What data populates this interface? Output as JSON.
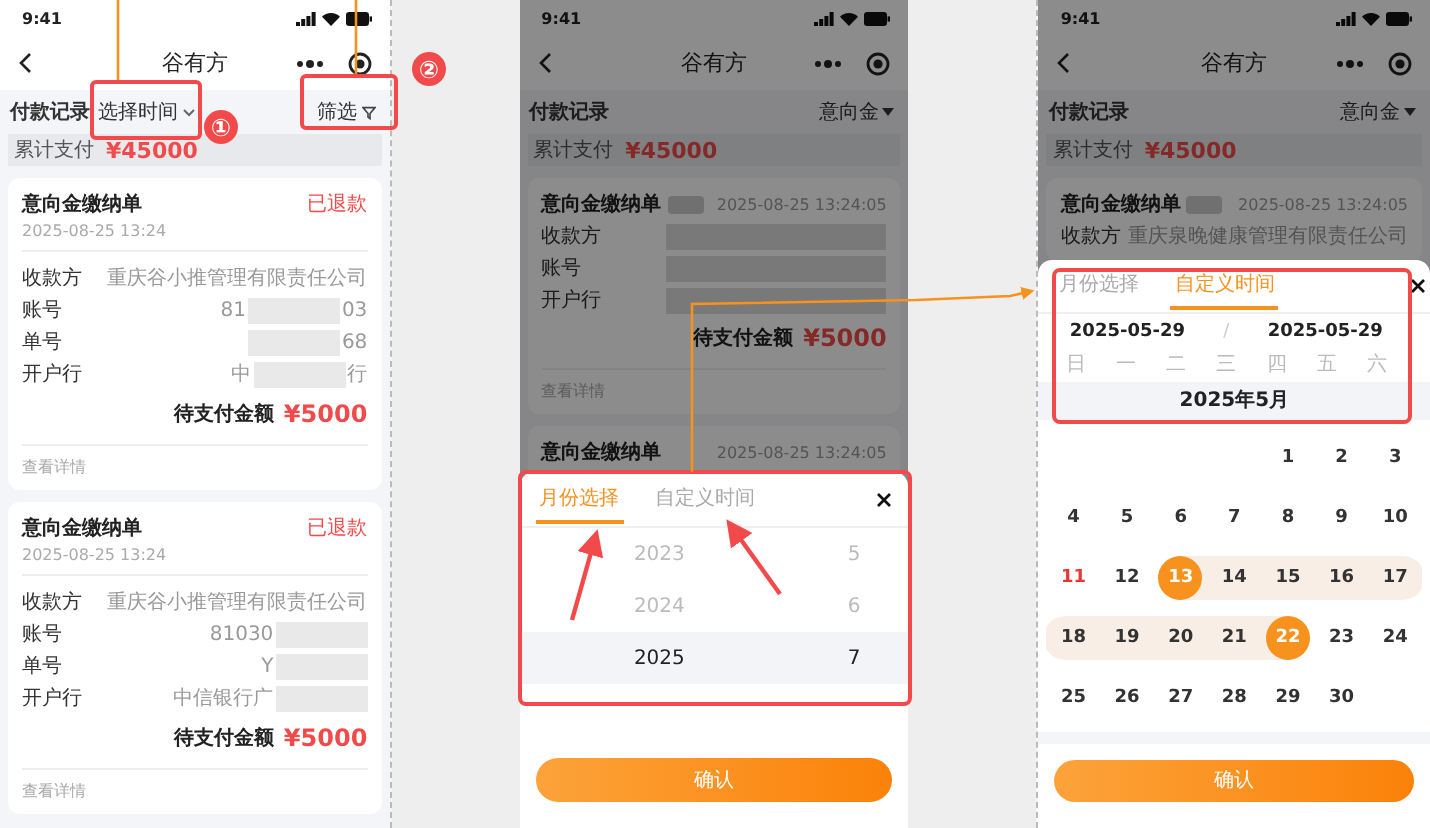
{
  "annotations": {
    "step_markers": [
      "①",
      "②"
    ]
  },
  "list_screen": {
    "time": "9:41",
    "title": "谷有方",
    "section_title": "付款记录",
    "time_filter": "选择时间",
    "filter": "筛选",
    "summary_label": "累计支付",
    "summary_amount": "¥45000",
    "cards": [
      {
        "title": "意向金缴纳单",
        "status": "已退款",
        "date": "2025-08-25 13:24",
        "fields": [
          {
            "label": "收款方",
            "value": "重庆谷小推管理有限责任公司",
            "masked": false
          },
          {
            "label": "账号",
            "value": "81",
            "value_end": "03",
            "masked": true
          },
          {
            "label": "单号",
            "value_end": "68",
            "masked": true
          },
          {
            "label": "开户行",
            "value": "中",
            "value_end": "行",
            "masked": true
          }
        ],
        "amount_label": "待支付金额",
        "amount": "¥5000",
        "link": "查看详情"
      },
      {
        "title": "意向金缴纳单",
        "status": "已退款",
        "date": "2025-08-25 13:24",
        "fields": [
          {
            "label": "收款方",
            "value": "重庆谷小推管理有限责任公司",
            "masked": false
          },
          {
            "label": "账号",
            "value": "81030",
            "masked": true
          },
          {
            "label": "单号",
            "value": "Y",
            "masked": true
          },
          {
            "label": "开户行",
            "value": "中信银行广",
            "masked": true
          }
        ],
        "amount_label": "待支付金额",
        "amount": "¥5000",
        "link": "查看详情"
      }
    ]
  },
  "month_screen": {
    "time": "9:41",
    "title": "谷有方",
    "section_title": "付款记录",
    "type_filter": "意向金",
    "summary_label": "累计支付",
    "summary_amount": "¥45000",
    "card": {
      "title": "意向金缴纳单",
      "date": "2025-08-25 13:24:05",
      "field_labels": [
        "收款方",
        "账号",
        "开户行"
      ],
      "amount_label": "待支付金额",
      "amount": "¥5000",
      "link": "查看详情"
    },
    "next_card": {
      "title": "意向金缴纳单",
      "date": "2025-08-25 13:24:05"
    },
    "sheet": {
      "tabs": [
        {
          "label": "月份选择",
          "selected": true
        },
        {
          "label": "自定义时间",
          "selected": false
        }
      ],
      "rows": [
        {
          "year": "2023",
          "month": "5",
          "selected": false
        },
        {
          "year": "2024",
          "month": "6",
          "selected": false
        },
        {
          "year": "2025",
          "month": "7",
          "selected": true
        }
      ],
      "confirm": "确认"
    }
  },
  "range_screen": {
    "time": "9:41",
    "title": "谷有方",
    "section_title": "付款记录",
    "type_filter": "意向金",
    "summary_label": "累计支付",
    "summary_amount": "¥45000",
    "card": {
      "title": "意向金缴纳单",
      "date": "2025-08-25 13:24:05",
      "fields": [
        {
          "label": "收款方",
          "value": "重庆泉晚健康管理有限责任公司"
        }
      ]
    },
    "sheet": {
      "tabs": [
        {
          "label": "月份选择",
          "selected": false
        },
        {
          "label": "自定义时间",
          "selected": true
        }
      ],
      "start_date": "2025-05-29",
      "separator": "/",
      "end_date": "2025-05-29",
      "weekdays": [
        "日",
        "一",
        "二",
        "三",
        "四",
        "五",
        "六"
      ],
      "month_title": "2025年5月",
      "days": [
        {
          "kind": "blank"
        },
        {
          "kind": "blank"
        },
        {
          "kind": "blank"
        },
        {
          "kind": "blank"
        },
        {
          "kind": "day",
          "label": "1"
        },
        {
          "kind": "day",
          "label": "2"
        },
        {
          "kind": "day",
          "label": "3"
        },
        {
          "kind": "day",
          "label": "4"
        },
        {
          "kind": "day",
          "label": "5"
        },
        {
          "kind": "day",
          "label": "6"
        },
        {
          "kind": "day",
          "label": "7"
        },
        {
          "kind": "day",
          "label": "8"
        },
        {
          "kind": "day",
          "label": "9"
        },
        {
          "kind": "day",
          "label": "10"
        },
        {
          "kind": "holiday",
          "label": "11"
        },
        {
          "kind": "day",
          "label": "12"
        },
        {
          "kind": "start",
          "label": "13"
        },
        {
          "kind": "range",
          "label": "14"
        },
        {
          "kind": "range",
          "label": "15"
        },
        {
          "kind": "range",
          "label": "16"
        },
        {
          "kind": "range",
          "label": "17"
        },
        {
          "kind": "range",
          "label": "18"
        },
        {
          "kind": "range",
          "label": "19"
        },
        {
          "kind": "range",
          "label": "20"
        },
        {
          "kind": "range",
          "label": "21"
        },
        {
          "kind": "end",
          "label": "22"
        },
        {
          "kind": "day",
          "label": "23"
        },
        {
          "kind": "day",
          "label": "24"
        },
        {
          "kind": "day",
          "label": "25"
        },
        {
          "kind": "day",
          "label": "26"
        },
        {
          "kind": "day",
          "label": "27"
        },
        {
          "kind": "day",
          "label": "28"
        },
        {
          "kind": "day",
          "label": "29"
        },
        {
          "kind": "day",
          "label": "30"
        }
      ],
      "confirm": "确认"
    }
  }
}
